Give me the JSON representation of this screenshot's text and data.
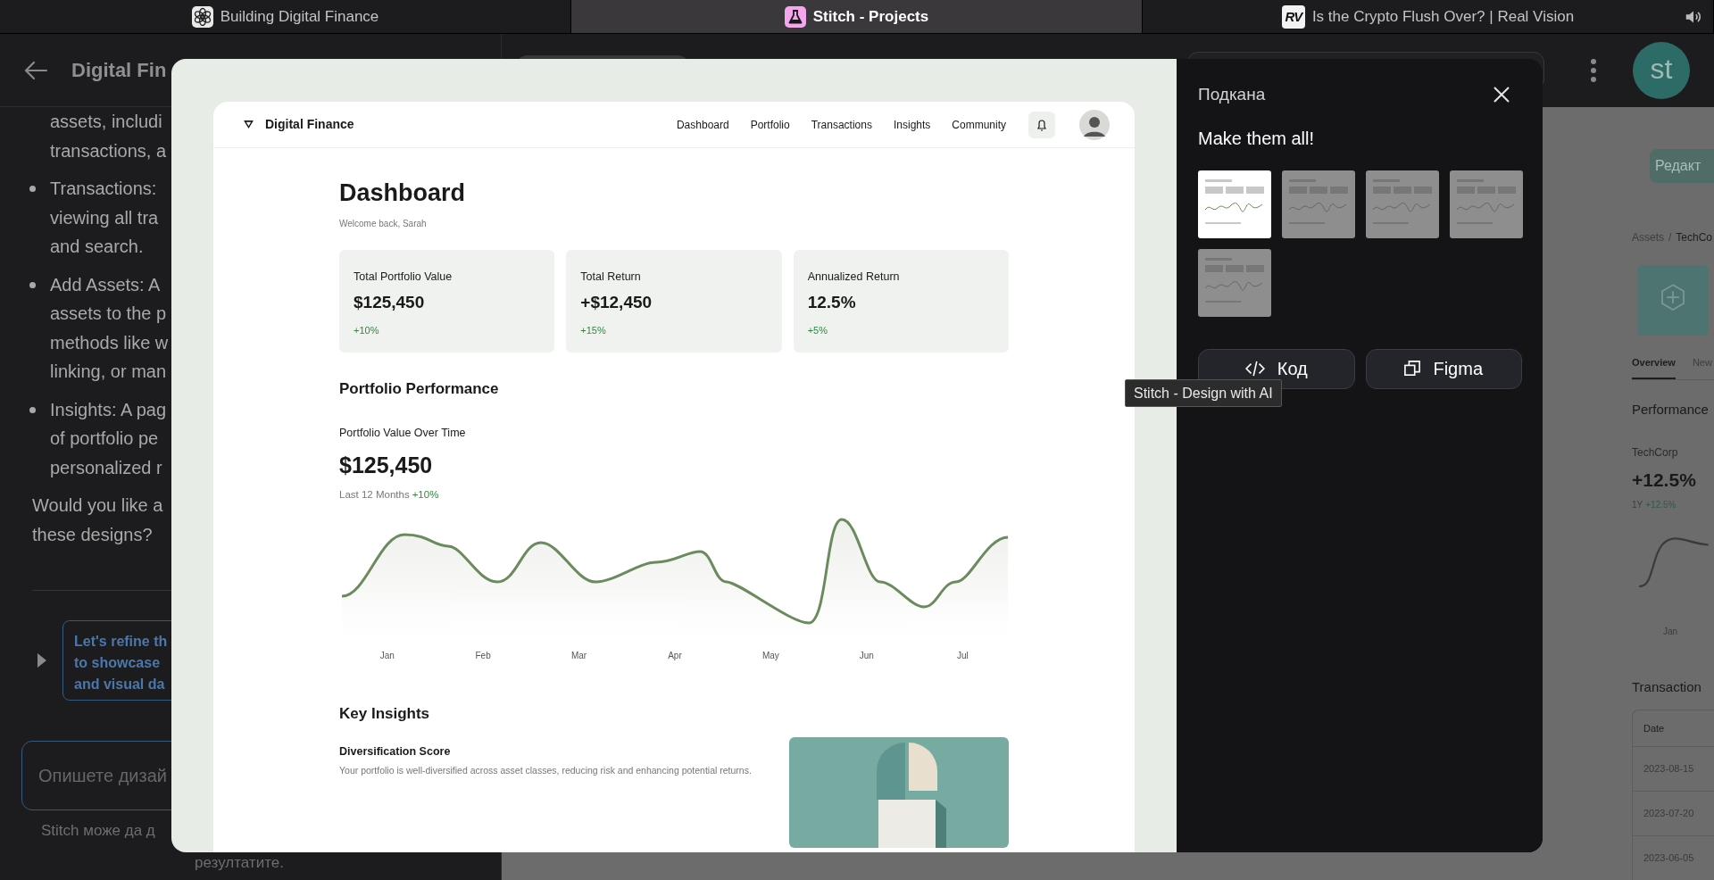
{
  "browser_tabs": [
    {
      "title": "Building Digital Finance",
      "selected": false,
      "kind": "knot"
    },
    {
      "title": "Stitch - Projects",
      "selected": true,
      "kind": "flask"
    },
    {
      "title": "Is the Crypto Flush Over? | Real Vision",
      "selected": false,
      "kind": "monogram",
      "logo_text": "RV"
    }
  ],
  "user": {
    "initials": "st"
  },
  "chat": {
    "title": "Digital Fin",
    "blocks": [
      {
        "kind": "continuation",
        "lines": [
          "assets, includi",
          "transactions, a"
        ]
      },
      {
        "kind": "bullet",
        "lines": [
          "Transactions:",
          "viewing all tra",
          "and search."
        ]
      },
      {
        "kind": "bullet",
        "lines": [
          "Add Assets: A",
          "assets to the p",
          "methods like w",
          "linking, or man"
        ]
      },
      {
        "kind": "bullet",
        "lines": [
          "Insights: A pag",
          "of portfolio pe",
          "personalized r"
        ]
      },
      {
        "kind": "paragraph",
        "lines": [
          "Would you like a",
          "these designs?"
        ]
      }
    ],
    "suggestion": [
      "Let's refine th",
      "to showcase",
      "and visual da"
    ],
    "input_placeholder": "Опишете дизай",
    "disclaimer": [
      "Stitch може да д",
      "резултатите."
    ]
  },
  "modal": {
    "preview": {
      "brand": "Digital Finance",
      "nav": [
        "Dashboard",
        "Portfolio",
        "Transactions",
        "Insights",
        "Community"
      ],
      "title": "Dashboard",
      "subtitle": "Welcome back, Sarah",
      "stats": [
        {
          "label": "Total Portfolio Value",
          "value": "$125,450",
          "change": "+10%"
        },
        {
          "label": "Total Return",
          "value": "+$12,450",
          "change": "+15%"
        },
        {
          "label": "Annualized Return",
          "value": "12.5%",
          "change": "+5%"
        }
      ],
      "performance": {
        "heading": "Portfolio Performance",
        "label": "Portfolio Value Over Time",
        "value": "$125,450",
        "period": "Last 12 Months",
        "change": "+10%",
        "months": [
          "Jan",
          "Feb",
          "Mar",
          "Apr",
          "May",
          "Jun",
          "Jul"
        ]
      },
      "insights": {
        "heading": "Key Insights",
        "items": [
          {
            "title": "Diversification Score",
            "text": "Your portfolio is well-diversified across asset classes, reducing risk and enhancing potential returns."
          }
        ]
      }
    },
    "prompt_label": "Подкана",
    "prompt": "Make them all!",
    "thumbnails": [
      {
        "selected": true
      },
      {
        "selected": false
      },
      {
        "selected": false
      },
      {
        "selected": false
      },
      {
        "selected": false
      }
    ],
    "actions": [
      {
        "label": "Код",
        "kind": "code"
      },
      {
        "label": "Figma",
        "kind": "figma"
      }
    ],
    "tooltip": "Stitch - Design with AI"
  },
  "asset_page": {
    "edit_button": "Редакт",
    "breadcrumb": [
      "Assets",
      "TechCo"
    ],
    "breadcrumb_separator": "/",
    "tabs": [
      {
        "label": "Overview",
        "selected": true
      },
      {
        "label": "New",
        "selected": false
      }
    ],
    "performance_heading": "Performance",
    "asset": "TechCorp",
    "return": "+12.5%",
    "period": "1Y",
    "period_change": "+12.5%",
    "chart_month": "Jan",
    "transactions_heading": "Transaction",
    "table": {
      "columns": [
        "Date"
      ],
      "rows": [
        [
          "2023-08-15"
        ],
        [
          "2023-07-20"
        ],
        [
          "2023-06-05"
        ]
      ]
    }
  }
}
